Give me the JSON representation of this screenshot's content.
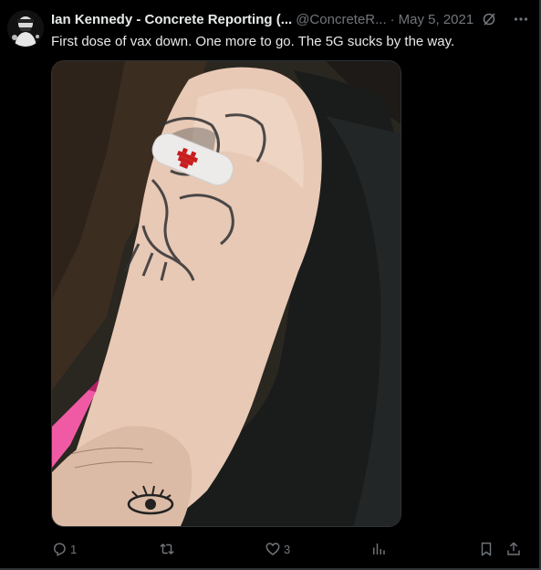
{
  "tweet": {
    "author_name": "Ian Kennedy - Concrete Reporting (...",
    "author_handle": "@ConcreteR...",
    "separator": "·",
    "date": "May 5, 2021",
    "text": "First dose of vax down. One more to go. The 5G sucks by the way."
  },
  "media": {
    "icon": "photo-arm-bandage"
  },
  "actions": {
    "reply_count": "1",
    "retweet_count": "",
    "like_count": "3",
    "views_count": ""
  },
  "colors": {
    "background": "#000000",
    "text_primary": "#e7e9ea",
    "text_secondary": "#71767b",
    "border": "#2f3336"
  }
}
